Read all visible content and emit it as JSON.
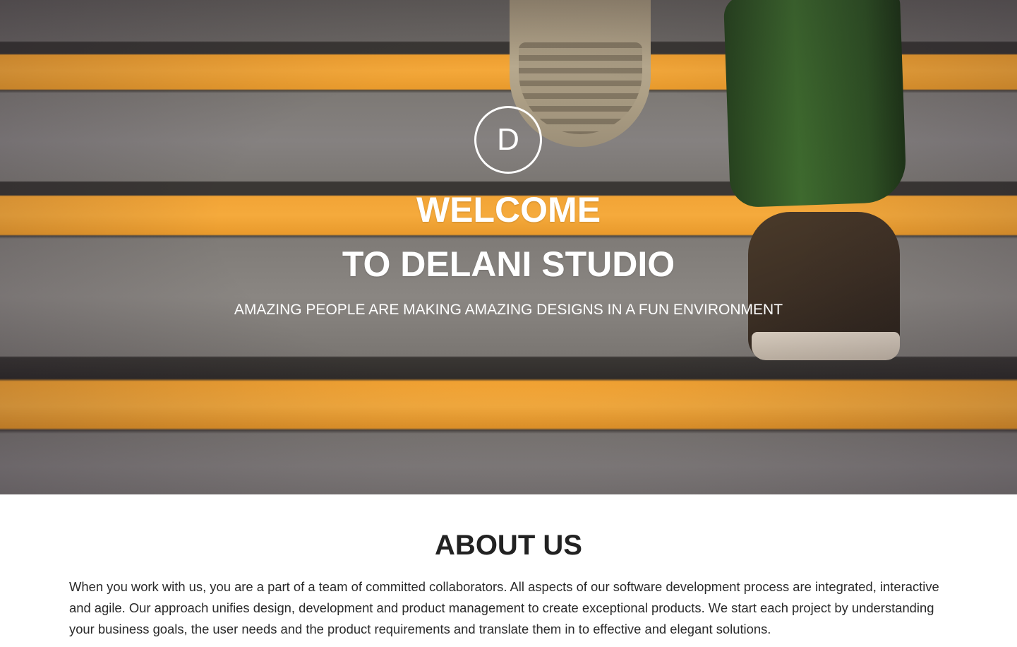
{
  "hero": {
    "logo_letter": "D",
    "title_line1": "WELCOME",
    "title_line2": "TO DELANI STUDIO",
    "subtitle": "AMAZING PEOPLE ARE MAKING AMAZING DESIGNS IN A FUN ENVIRONMENT"
  },
  "about": {
    "heading": "ABOUT US",
    "paragraph": "When you work with us, you are a part of a team of committed collaborators. All aspects of our software development process are integrated, interactive and agile. Our approach unifies design, development and product management to create exceptional products. We start each project by understanding your business goals, the user needs and the product requirements and translate them in to effective and elegant solutions."
  },
  "colors": {
    "stair_stripe": "#f4a83a",
    "about_text": "#2a2a2a",
    "hero_text": "#ffffff"
  }
}
